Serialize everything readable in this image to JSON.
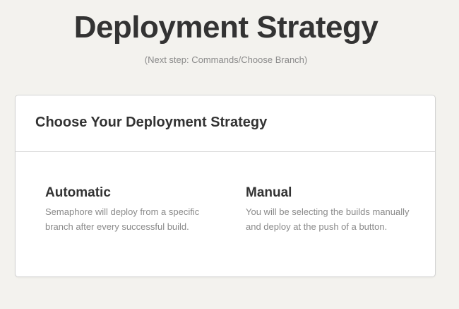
{
  "header": {
    "title": "Deployment Strategy",
    "subtitle": "(Next step: Commands/Choose Branch)"
  },
  "card": {
    "title": "Choose Your Deployment Strategy",
    "options": [
      {
        "title": "Automatic",
        "description": "Semaphore will deploy from a specific branch after every successful build."
      },
      {
        "title": "Manual",
        "description": "You will be selecting the builds manually and deploy at the push of a button."
      }
    ]
  }
}
